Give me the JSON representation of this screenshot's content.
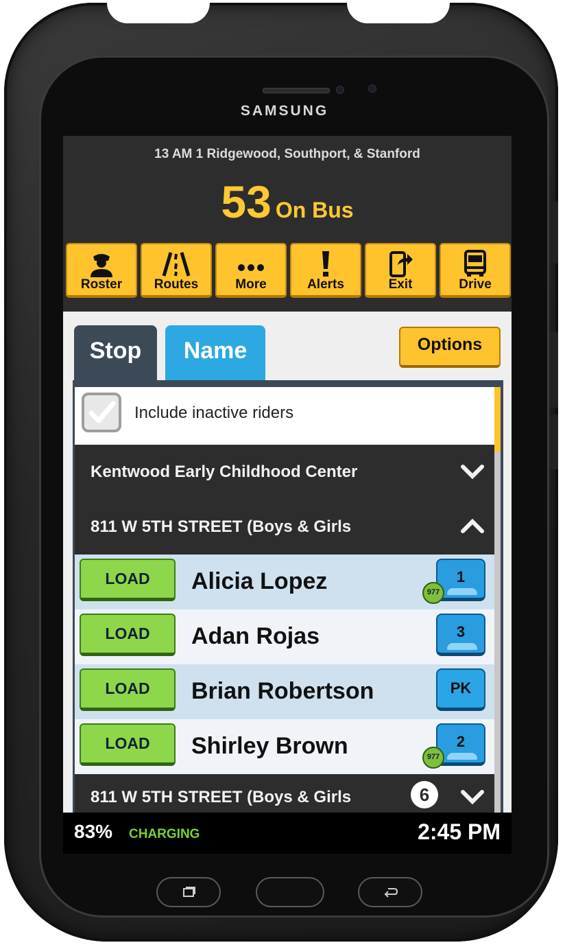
{
  "device": {
    "brand": "SAMSUNG",
    "nav_buttons": [
      "recent-apps",
      "home",
      "back"
    ]
  },
  "header": {
    "route_title": "13 AM 1 Ridgewood, Southport, & Stanford",
    "on_bus_count": "53",
    "on_bus_label": "On Bus"
  },
  "toolbar": [
    {
      "label": "Roster",
      "icon": "driver-icon"
    },
    {
      "label": "Routes",
      "icon": "road-icon"
    },
    {
      "label": "More",
      "icon": "ellipsis-icon"
    },
    {
      "label": "Alerts",
      "icon": "exclamation-icon"
    },
    {
      "label": "Exit",
      "icon": "exit-phone-icon"
    },
    {
      "label": "Drive",
      "icon": "bus-icon"
    }
  ],
  "tabs": [
    {
      "label": "Stop",
      "active": true
    },
    {
      "label": "Name",
      "active": false
    }
  ],
  "options_label": "Options",
  "filter": {
    "label": "Include inactive riders",
    "checked": true
  },
  "stops": [
    {
      "name": "Kentwood Early Childhood Center",
      "expanded": false
    },
    {
      "name": "811 W 5TH STREET (Boys & Girls",
      "expanded": true
    },
    {
      "name": "811 W 5TH STREET (Boys & Girls",
      "expanded": false,
      "count": "6"
    }
  ],
  "riders": [
    {
      "action": "LOAD",
      "name": "Alicia Lopez",
      "grade": "1",
      "tag": "977"
    },
    {
      "action": "LOAD",
      "name": "Adan Rojas",
      "grade": "3"
    },
    {
      "action": "LOAD",
      "name": "Brian Robertson",
      "grade": "PK"
    },
    {
      "action": "LOAD",
      "name": "Shirley Brown",
      "grade": "2",
      "tag": "977"
    }
  ],
  "status": {
    "battery": "83%",
    "charging": "CHARGING",
    "time": "2:45 PM"
  },
  "colors": {
    "accent_yellow": "#ffc32e",
    "tab_blue": "#2ea8e0",
    "tab_dark": "#3c4a58",
    "load_green": "#8ed64a",
    "charging_green": "#7bd12f"
  }
}
